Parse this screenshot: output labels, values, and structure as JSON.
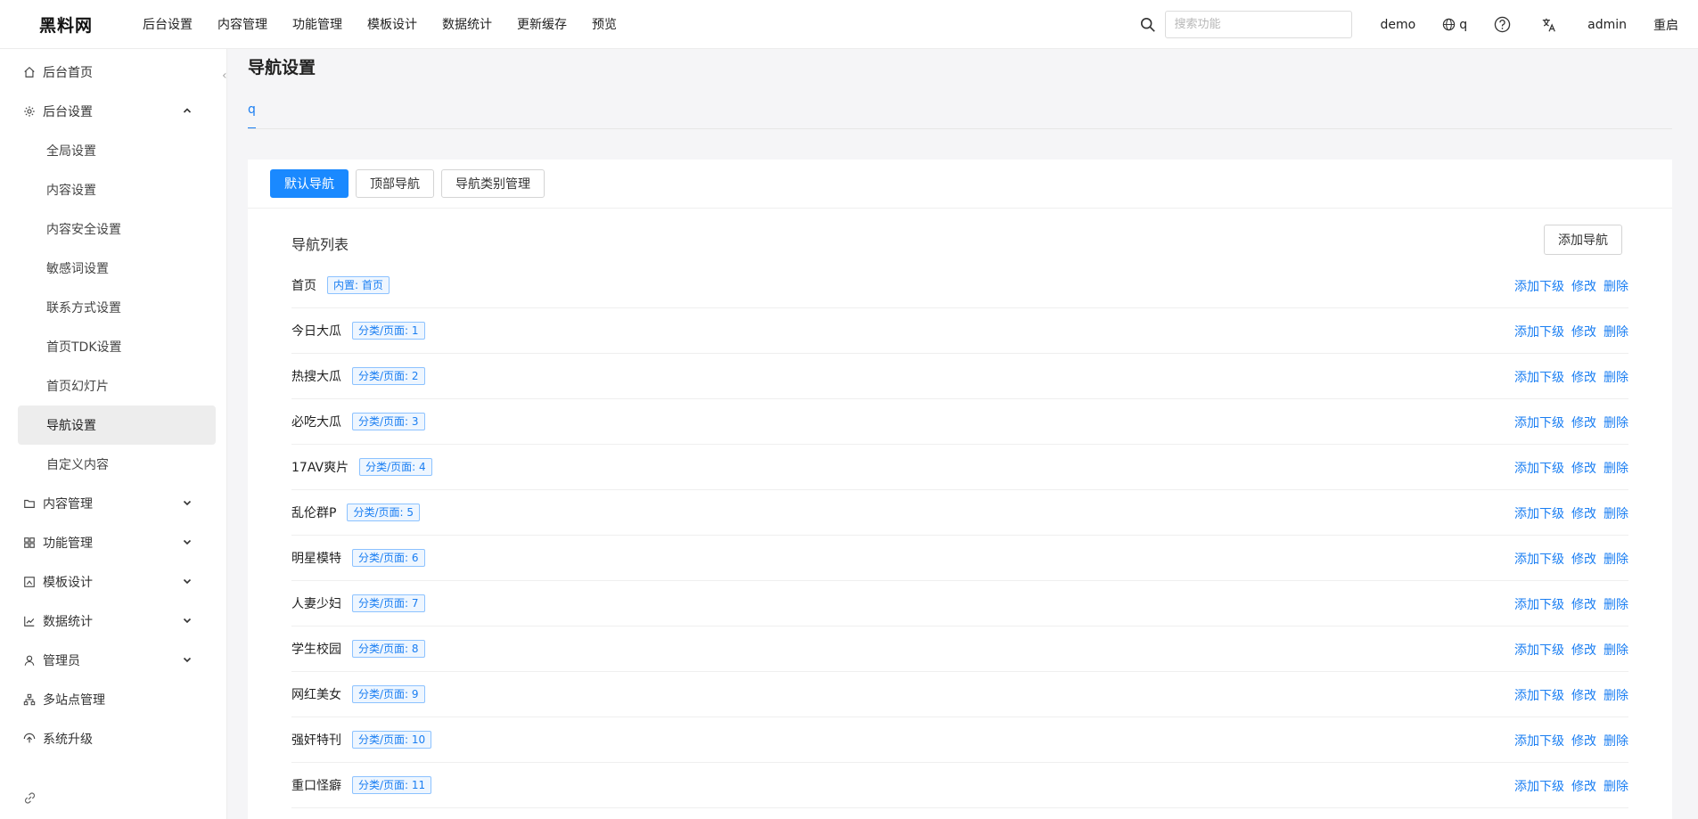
{
  "app": {
    "logo": "黑料网"
  },
  "topnav": [
    "后台设置",
    "内容管理",
    "功能管理",
    "模板设计",
    "数据统计",
    "更新缓存",
    "预览"
  ],
  "search": {
    "placeholder": "搜索功能",
    "value": ""
  },
  "topright": {
    "site": "demo",
    "lang": "q",
    "user": "admin",
    "restart": "重启"
  },
  "sidebar": {
    "home": "后台首页",
    "settings": "后台设置",
    "settings_children": [
      "全局设置",
      "内容设置",
      "内容安全设置",
      "敏感词设置",
      "联系方式设置",
      "首页TDK设置",
      "首页幻灯片",
      "导航设置",
      "自定义内容"
    ],
    "active": "导航设置",
    "groups": [
      {
        "label": "内容管理",
        "icon": "folder-icon"
      },
      {
        "label": "功能管理",
        "icon": "grid-icon"
      },
      {
        "label": "模板设计",
        "icon": "template-icon"
      },
      {
        "label": "数据统计",
        "icon": "chart-icon"
      },
      {
        "label": "管理员",
        "icon": "user-icon"
      }
    ],
    "multisite": "多站点管理",
    "upgrade": "系统升级"
  },
  "main": {
    "title": "导航设置",
    "site_tab": "q",
    "buttons": [
      "默认导航",
      "顶部导航",
      "导航类别管理"
    ],
    "list_title": "导航列表",
    "add_button": "添加导航",
    "actions": {
      "add_child": "添加下级",
      "edit": "修改",
      "delete": "删除"
    },
    "rows": [
      {
        "name": "首页",
        "tag": "内置: 首页"
      },
      {
        "name": "今日大瓜",
        "tag": "分类/页面: 1"
      },
      {
        "name": "热搜大瓜",
        "tag": "分类/页面: 2"
      },
      {
        "name": "必吃大瓜",
        "tag": "分类/页面: 3"
      },
      {
        "name": "17AV爽片",
        "tag": "分类/页面: 4"
      },
      {
        "name": "乱伦群P",
        "tag": "分类/页面: 5"
      },
      {
        "name": "明星模特",
        "tag": "分类/页面: 6"
      },
      {
        "name": "人妻少妇",
        "tag": "分类/页面: 7"
      },
      {
        "name": "学生校园",
        "tag": "分类/页面: 8"
      },
      {
        "name": "网红美女",
        "tag": "分类/页面: 9"
      },
      {
        "name": "强奸特刊",
        "tag": "分类/页面: 10"
      },
      {
        "name": "重口怪癖",
        "tag": "分类/页面: 11"
      }
    ]
  }
}
